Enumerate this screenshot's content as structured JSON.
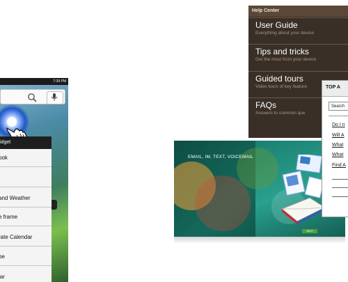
{
  "left_phone": {
    "status_time": "7:39 PM",
    "menu_header": "idget",
    "menu_items": [
      {
        "label": "ook"
      },
      {
        "label": ""
      },
      {
        "label": "and Weather"
      },
      {
        "label": "e frame"
      },
      {
        "label": "rate Calendar"
      },
      {
        "label": "be"
      },
      {
        "label": "lar"
      }
    ],
    "side_tab": "et"
  },
  "help_center": {
    "title": "Help Center",
    "items": [
      {
        "title": "User Guide",
        "subtitle": "Everything about your device"
      },
      {
        "title": "Tips and tricks",
        "subtitle": "Get the most from your device"
      },
      {
        "title": "Guided tours",
        "subtitle": "Video tours of key feature"
      },
      {
        "title": "FAQs",
        "subtitle": "Answers to common que"
      }
    ]
  },
  "faq_panel": {
    "title": "TOP A",
    "search_placeholder": "Search",
    "links": [
      "Do I n",
      "Will A",
      "What",
      "What",
      "Find A"
    ]
  },
  "video_card": {
    "caption": "EMAIL, IM, TEXT, VOICEMAIL",
    "badge": "NEXT"
  }
}
